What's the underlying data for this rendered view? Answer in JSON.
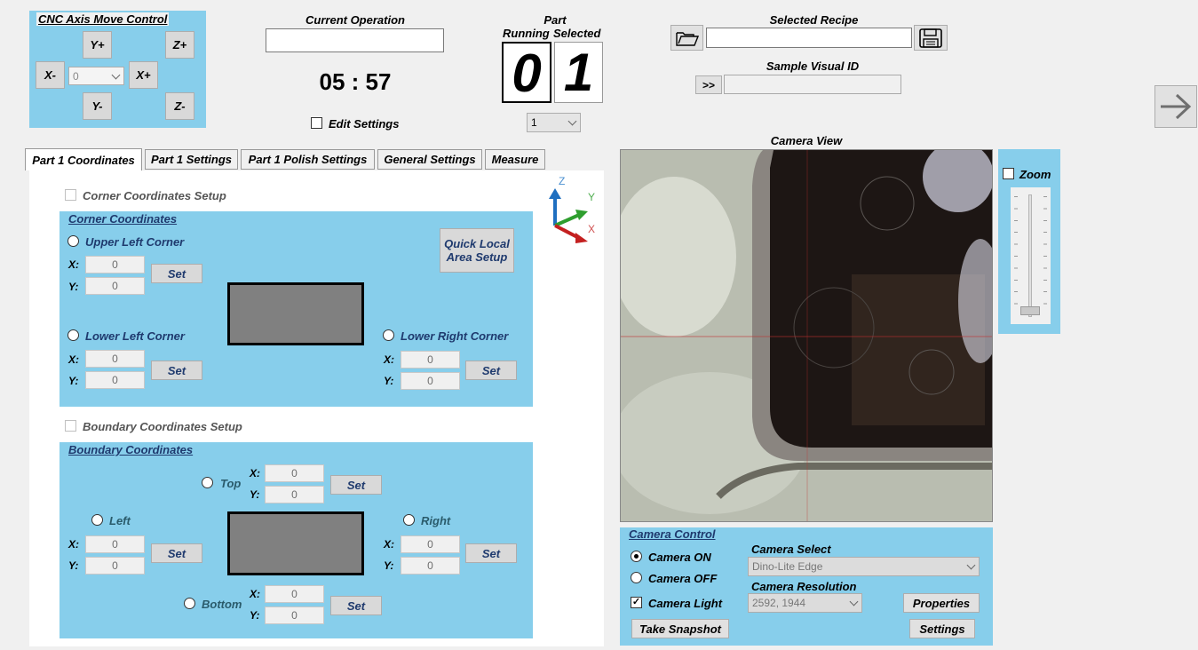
{
  "cnc": {
    "title": "CNC Axis Move Control",
    "y_plus": "Y+",
    "y_minus": "Y-",
    "x_plus": "X+",
    "x_minus": "X-",
    "z_plus": "Z+",
    "z_minus": "Z-",
    "step_value": "0"
  },
  "operation": {
    "title": "Current Operation",
    "value": "",
    "timer": "05 : 57",
    "edit_settings": "Edit Settings"
  },
  "part": {
    "title": "Part",
    "running_label": "Running",
    "selected_label": "Selected",
    "running": "0",
    "selected": "1",
    "dropdown_value": "1"
  },
  "recipe": {
    "title": "Selected Recipe",
    "value": "",
    "sample_title": "Sample Visual ID",
    "sample_button": ">>",
    "sample_value": ""
  },
  "tabs": [
    "Part 1 Coordinates",
    "Part 1 Settings",
    "Part 1 Polish Settings",
    "General Settings",
    "Measure"
  ],
  "corner": {
    "setup_label": "Corner Coordinates Setup",
    "group_title": "Corner Coordinates",
    "upper_left": "Upper Left Corner",
    "lower_left": "Lower Left Corner",
    "lower_right": "Lower Right Corner",
    "quick_setup": "Quick Local Area Setup",
    "x_label": "X:",
    "y_label": "Y:",
    "set": "Set",
    "ul_x": "0",
    "ul_y": "0",
    "ll_x": "0",
    "ll_y": "0",
    "lr_x": "0",
    "lr_y": "0"
  },
  "axes_gizmo": {
    "z": "Z",
    "y": "Y",
    "x": "X"
  },
  "boundary": {
    "setup_label": "Boundary Coordinates Setup",
    "group_title": "Boundary Coordinates",
    "top": "Top",
    "left": "Left",
    "right": "Right",
    "bottom": "Bottom",
    "set": "Set",
    "x_label": "X:",
    "y_label": "Y:",
    "top_x": "0",
    "top_y": "0",
    "left_x": "0",
    "left_y": "0",
    "right_x": "0",
    "right_y": "0",
    "bottom_x": "0",
    "bottom_y": "0"
  },
  "camera": {
    "view_title": "Camera View",
    "zoom_label": "Zoom",
    "zoom_level": 0,
    "control_title": "Camera Control",
    "on_label": "Camera ON",
    "off_label": "Camera OFF",
    "light_label": "Camera Light",
    "select_title": "Camera Select",
    "select_value": "Dino-Lite Edge",
    "resolution_title": "Camera Resolution",
    "resolution_value": "2592, 1944",
    "properties": "Properties",
    "snapshot": "Take Snapshot",
    "settings": "Settings",
    "state": "on",
    "light_on": true
  },
  "icons": {
    "folder": "folder-open-icon",
    "save": "floppy-disk-icon",
    "next": "arrow-right-icon"
  }
}
